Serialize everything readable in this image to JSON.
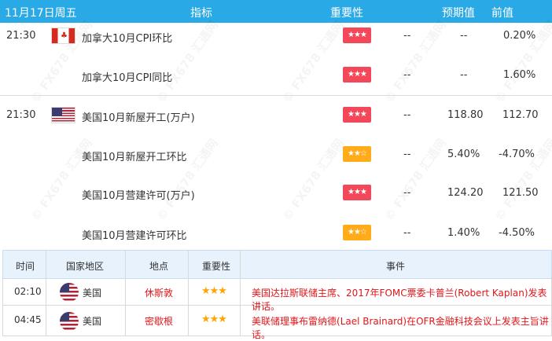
{
  "header": {
    "date": "11月17日周五",
    "indicator": "指标",
    "importance": "重要性",
    "forecast": "预期值",
    "previous": "前值"
  },
  "watermark_text": "© FX678 汇通网",
  "calendar": [
    {
      "time": "21:30",
      "flag": "ca",
      "name": "加拿大10月CPI环比",
      "stars": "★★★",
      "actual": "--",
      "forecast": "--",
      "previous": "0.20%"
    },
    {
      "time": "",
      "flag": "",
      "name": "加拿大10月CPI同比",
      "stars": "★★★",
      "actual": "--",
      "forecast": "--",
      "previous": "1.60%"
    },
    {
      "time": "21:30",
      "flag": "us",
      "name": "美国10月新屋开工(万户)",
      "stars": "★★★",
      "actual": "--",
      "forecast": "118.80",
      "previous": "112.70"
    },
    {
      "time": "",
      "flag": "",
      "name": "美国10月新屋开工环比",
      "stars": "★★☆",
      "actual": "--",
      "forecast": "5.40%",
      "previous": "-4.70%"
    },
    {
      "time": "",
      "flag": "",
      "name": "美国10月营建许可(万户)",
      "stars": "★★★",
      "actual": "--",
      "forecast": "124.20",
      "previous": "121.50"
    },
    {
      "time": "",
      "flag": "",
      "name": "美国10月营建许可环比",
      "stars": "★★☆",
      "actual": "--",
      "forecast": "1.40%",
      "previous": "-4.50%"
    }
  ],
  "events": {
    "headers": {
      "time": "时间",
      "region": "国家地区",
      "location": "地点",
      "importance": "重要性",
      "event": "事件"
    },
    "rows": [
      {
        "time": "02:10",
        "region": "美国",
        "location": "休斯敦",
        "stars": "★★★",
        "event": "美国达拉斯联储主席、2017年FOMC票委卡普兰(Robert Kaplan)发表讲话。"
      },
      {
        "time": "04:45",
        "region": "美国",
        "location": "密歇根",
        "stars": "★★★",
        "event": "美联储理事布雷纳德(Lael Brainard)在OFR金融科技会议上发表主旨讲话。"
      }
    ]
  },
  "colors": {
    "header_bg": "#29a9e6",
    "badge_high": "#f2485a",
    "badge_mid": "#ffab1a",
    "event_text": "#e0161a",
    "star": "#ffa500"
  }
}
